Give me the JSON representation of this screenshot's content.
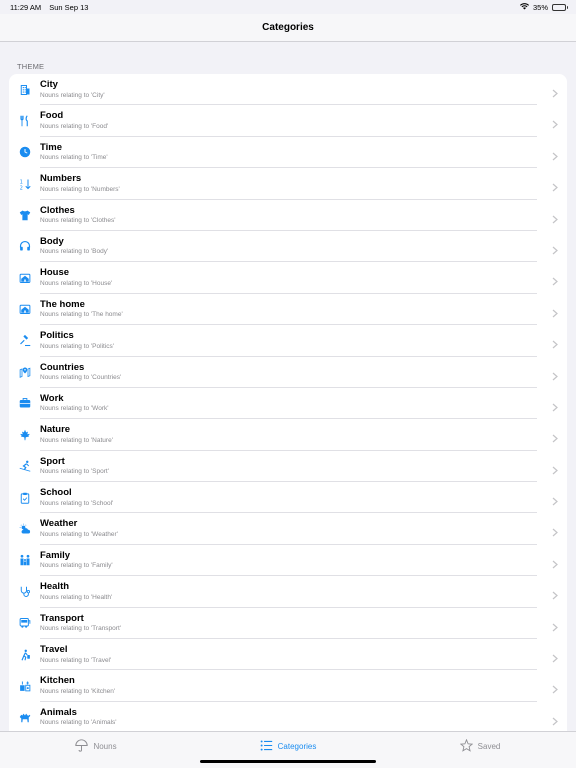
{
  "status": {
    "time": "11:29 AM",
    "date": "Sun Sep 13",
    "battery": "35%",
    "battery_level": 0.35
  },
  "nav": {
    "title": "Categories"
  },
  "section": {
    "header": "THEME"
  },
  "accent_color": "#1a8cf0",
  "items": [
    {
      "title": "City",
      "subtitle": "Nouns relating to 'City'",
      "icon": "building-icon"
    },
    {
      "title": "Food",
      "subtitle": "Nouns relating to 'Food'",
      "icon": "fork-knife-icon"
    },
    {
      "title": "Time",
      "subtitle": "Nouns relating to 'Time'",
      "icon": "clock-icon"
    },
    {
      "title": "Numbers",
      "subtitle": "Nouns relating to 'Numbers'",
      "icon": "numbers-sort-icon"
    },
    {
      "title": "Clothes",
      "subtitle": "Nouns relating to 'Clothes'",
      "icon": "tshirt-icon"
    },
    {
      "title": "Body",
      "subtitle": "Nouns relating to 'Body'",
      "icon": "headphones-icon"
    },
    {
      "title": "House",
      "subtitle": "Nouns relating to 'House'",
      "icon": "house-icon"
    },
    {
      "title": "The home",
      "subtitle": "Nouns relating to 'The home'",
      "icon": "home-icon"
    },
    {
      "title": "Politics",
      "subtitle": "Nouns relating to 'Politics'",
      "icon": "gavel-icon"
    },
    {
      "title": "Countries",
      "subtitle": "Nouns relating to 'Countries'",
      "icon": "map-pin-icon"
    },
    {
      "title": "Work",
      "subtitle": "Nouns relating to 'Work'",
      "icon": "briefcase-icon"
    },
    {
      "title": "Nature",
      "subtitle": "Nouns relating to 'Nature'",
      "icon": "maple-leaf-icon"
    },
    {
      "title": "Sport",
      "subtitle": "Nouns relating to 'Sport'",
      "icon": "skiing-icon"
    },
    {
      "title": "School",
      "subtitle": "Nouns relating to 'School'",
      "icon": "clipboard-icon"
    },
    {
      "title": "Weather",
      "subtitle": "Nouns relating to 'Weather'",
      "icon": "sun-cloud-icon"
    },
    {
      "title": "Family",
      "subtitle": "Nouns relating to 'Family'",
      "icon": "family-icon"
    },
    {
      "title": "Health",
      "subtitle": "Nouns relating to 'Health'",
      "icon": "stethoscope-icon"
    },
    {
      "title": "Transport",
      "subtitle": "Nouns relating to 'Transport'",
      "icon": "bus-icon"
    },
    {
      "title": "Travel",
      "subtitle": "Nouns relating to 'Travel'",
      "icon": "traveler-icon"
    },
    {
      "title": "Kitchen",
      "subtitle": "Nouns relating to 'Kitchen'",
      "icon": "kitchen-icon"
    },
    {
      "title": "Animals",
      "subtitle": "Nouns relating to 'Animals'",
      "icon": "camel-icon"
    }
  ],
  "tabs": [
    {
      "label": "Nouns",
      "icon": "umbrella-icon",
      "active": false
    },
    {
      "label": "Categories",
      "icon": "list-icon",
      "active": true
    },
    {
      "label": "Saved",
      "icon": "star-icon",
      "active": false
    }
  ]
}
